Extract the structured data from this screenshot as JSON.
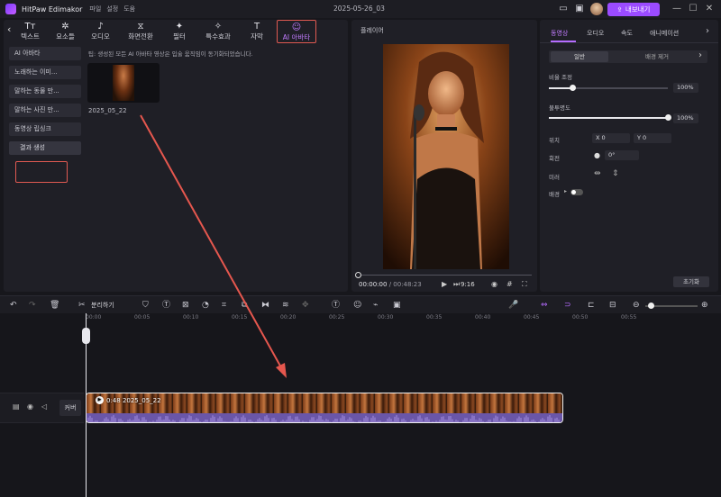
{
  "app": {
    "name": "HitPaw Edimakor",
    "menus": [
      "파일",
      "설정",
      "도움"
    ],
    "project_title": "2025-05-26_03",
    "export_label": "내보내기"
  },
  "toolbar": {
    "tabs": [
      {
        "label": "텍스트",
        "icon": "text-icon"
      },
      {
        "label": "요소들",
        "icon": "elements-icon"
      },
      {
        "label": "오디오",
        "icon": "music-icon"
      },
      {
        "label": "화면전환",
        "icon": "transition-icon"
      },
      {
        "label": "필터",
        "icon": "filter-icon"
      },
      {
        "label": "특수효과",
        "icon": "effects-icon"
      },
      {
        "label": "자막",
        "icon": "subtitle-icon"
      },
      {
        "label": "AI 아바타",
        "icon": "ai-avatar-icon"
      }
    ]
  },
  "sidebar": {
    "items": [
      "AI 아바타",
      "노래하는 이미...",
      "말하는 동물 만...",
      "말하는 사진 만...",
      "동영상 립싱크",
      "결과 생성"
    ]
  },
  "content": {
    "tip": "팁: 생성된 모든 AI 아바타 영상은 입술 움직임이 동기화되었습니다.",
    "thumb_label": "2025_05_22"
  },
  "player": {
    "label": "플레이어",
    "current_time": "00:00:00",
    "duration": "/ 00:48:23",
    "ratio": "9:16"
  },
  "properties": {
    "tabs": [
      "동영상",
      "오디오",
      "속도",
      "애니메이션"
    ],
    "subtabs": [
      "일반",
      "배경 제거"
    ],
    "scale_label": "비율 조정",
    "scale_value": "100%",
    "scale": 1.0,
    "opacity_label": "불투명도",
    "opacity_value": "100%",
    "opacity": 1.0,
    "position_label": "위치",
    "pos_x": "X  0",
    "pos_y": "Y  0",
    "rotate_label": "회전",
    "rotate_value": "0°",
    "mirror_label": "미러",
    "background_label": "배경",
    "reset_label": "초기화"
  },
  "timeline": {
    "split_label": "분리하기",
    "ruler": [
      "00:00",
      "00:05",
      "00:10",
      "00:15",
      "00:20",
      "00:25",
      "00:30",
      "00:35",
      "00:40",
      "00:45",
      "00:50",
      "00:55"
    ],
    "cover_label": "커버",
    "clip_label": "0:48 2025_05_22"
  }
}
